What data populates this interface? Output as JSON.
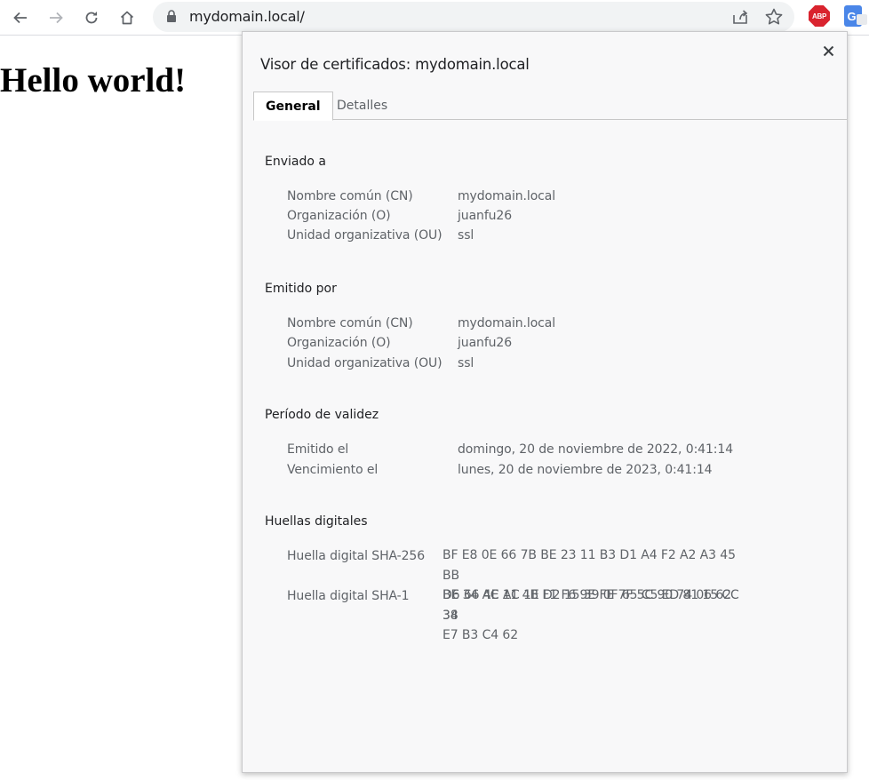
{
  "browser": {
    "url": "mydomain.local/",
    "extensions": {
      "abp_label": "ABP",
      "translate_label": "G"
    }
  },
  "page": {
    "heading": "Hello world!"
  },
  "dialog": {
    "title": "Visor de certificados: mydomain.local",
    "tabs": [
      "General",
      "Detalles"
    ],
    "issued_to": {
      "title": "Enviado a",
      "rows": [
        {
          "label": "Nombre común (CN)",
          "value": "mydomain.local"
        },
        {
          "label": "Organización (O)",
          "value": "juanfu26"
        },
        {
          "label": "Unidad organizativa (OU)",
          "value": "ssl"
        }
      ]
    },
    "issued_by": {
      "title": "Emitido por",
      "rows": [
        {
          "label": "Nombre común (CN)",
          "value": "mydomain.local"
        },
        {
          "label": "Organización (O)",
          "value": "juanfu26"
        },
        {
          "label": "Unidad organizativa (OU)",
          "value": "ssl"
        }
      ]
    },
    "validity": {
      "title": "Período de validez",
      "rows": [
        {
          "label": "Emitido el",
          "value": "domingo, 20 de noviembre de 2022, 0:41:14"
        },
        {
          "label": "Vencimiento el",
          "value": "lunes, 20 de noviembre de 2023, 0:41:14"
        }
      ]
    },
    "fingerprints": {
      "title": "Huellas digitales",
      "rows": [
        {
          "label": "Huella digital SHA-256",
          "value_lines": [
            "BF E8 0E 66 7B BE 23 11 B3 D1 A4 F2 A2 A3 45 BB",
            "BE 34 AC AC 1E D2 15 39 0F 65 C5 ED 81 15 CC 38"
          ]
        },
        {
          "label": "Huella digital SHA-1",
          "value_lines": [
            "D6 66 4E 11 4B F1 F6 9E FE 7F 5C 90 74 06 62 34",
            "E7 B3 C4 62"
          ]
        }
      ]
    }
  },
  "colors": {
    "abp": "#d9232e",
    "translate": "#4a86e8",
    "dialog_bg": "#f8f8f9"
  }
}
